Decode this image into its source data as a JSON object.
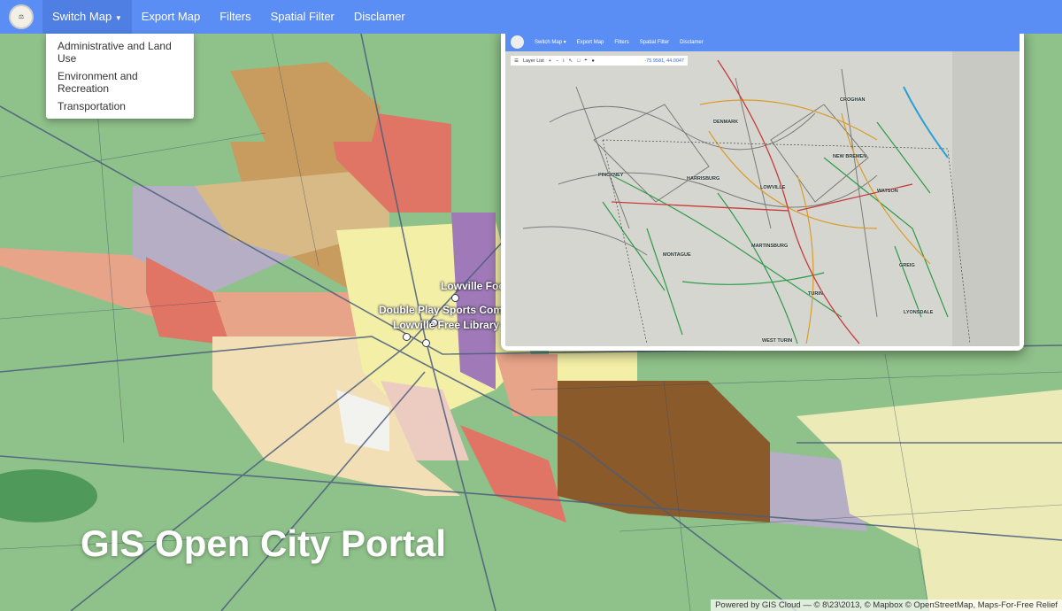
{
  "nav": {
    "logo_icon": "county-seal-logo",
    "items": [
      {
        "label": "Switch Map",
        "active": true,
        "has_dropdown": true
      },
      {
        "label": "Export Map"
      },
      {
        "label": "Filters"
      },
      {
        "label": "Spatial Filter"
      },
      {
        "label": "Disclamer"
      }
    ],
    "dropdown": [
      "Administrative and Land Use",
      "Environment and Recreation",
      "Transportation"
    ],
    "accent_color": "#5b8ef5"
  },
  "map": {
    "labels": [
      "Lowville Food",
      "Double Play Sports Comm",
      "Lowville Free Library"
    ],
    "title": "GIS Open City Portal",
    "attribution": "Powered by GIS Cloud — © 8\\23\\2013, © Mapbox © OpenStreetMap, Maps-For-Free Relief"
  },
  "inset": {
    "nav": [
      "Switch Map ▾",
      "Export Map",
      "Filters",
      "Spatial Filter",
      "Disclamer"
    ],
    "toolbar": {
      "layer_list": "Layer List",
      "coordinates": "-75.9581, 44.0047"
    },
    "towns": [
      "CROGHAN",
      "DENMARK",
      "NEW BREMEN",
      "PINCKNEY",
      "HARRISBURG",
      "LOWVILLE",
      "WATSON",
      "MARTINSBURG",
      "MONTAGUE",
      "GREIG",
      "TURIN",
      "LYONSDALE",
      "WEST TURIN"
    ]
  }
}
